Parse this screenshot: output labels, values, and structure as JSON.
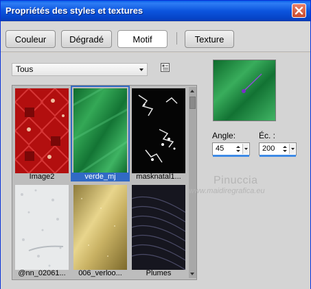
{
  "window": {
    "title": "Propriétés des styles et textures"
  },
  "tabs": [
    {
      "label": "Couleur",
      "active": false
    },
    {
      "label": "Dégradé",
      "active": false
    },
    {
      "label": "Motif",
      "active": true
    },
    {
      "label": "Texture",
      "active": false
    }
  ],
  "filter": {
    "selected": "Tous"
  },
  "patterns": [
    {
      "label": "Image2",
      "selected": false
    },
    {
      "label": "verde_mj",
      "selected": true
    },
    {
      "label": "masknatal1...",
      "selected": false
    },
    {
      "label": "@nn_02061...",
      "selected": false
    },
    {
      "label": "006_verloo...",
      "selected": false
    },
    {
      "label": "Plumes",
      "selected": false
    }
  ],
  "angle": {
    "label": "Angle:",
    "value": "45"
  },
  "scale": {
    "label": "Éc. :",
    "value": "200"
  },
  "watermark": {
    "line1": "Pinuccia",
    "line2": "www.maidiregrafica.eu"
  },
  "colors": {
    "accent": "#316ac5",
    "titlebar": "#0a5fe8",
    "close": "#c94a2c",
    "green": "#1f8a3e"
  }
}
